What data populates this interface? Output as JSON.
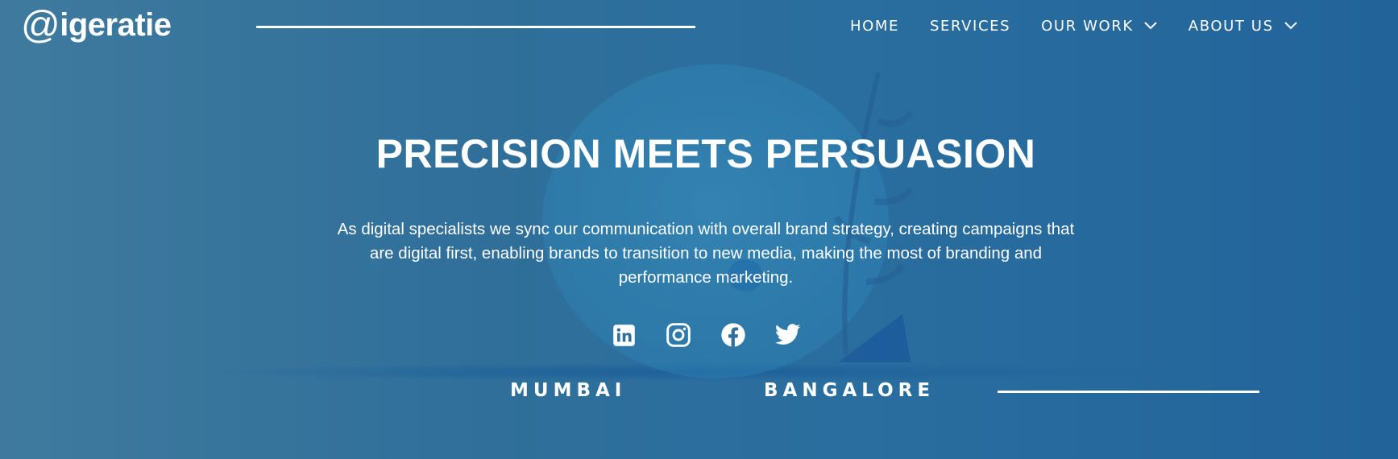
{
  "brand": {
    "logo_symbol": "@",
    "logo_text": "igeratie"
  },
  "nav": {
    "items": [
      {
        "label": "HOME"
      },
      {
        "label": "SERVICES"
      },
      {
        "label": "OUR WORK"
      },
      {
        "label": "ABOUT US"
      }
    ]
  },
  "hero": {
    "title": "PRECISION MEETS PERSUASION",
    "description": "As digital specialists we sync our communication with overall brand strategy, creating campaigns that are digital first, enabling brands to transition to new media, making the most of branding and performance marketing."
  },
  "social": {
    "icons": [
      "linkedin-icon",
      "instagram-icon",
      "facebook-icon",
      "twitter-icon"
    ]
  },
  "locations": {
    "cities": [
      "MUMBAI",
      "BANGALORE"
    ]
  },
  "colors": {
    "background": "#2f6f9a",
    "text": "#ffffff"
  }
}
